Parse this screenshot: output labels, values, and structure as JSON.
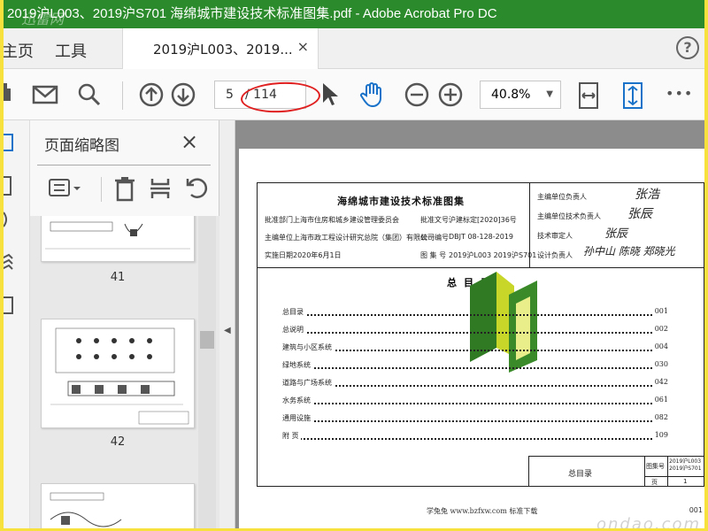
{
  "window": {
    "title": "2019沪L003、2019沪S701 海绵城市建设技术标准图集.pdf - Adobe Acrobat Pro DC",
    "watermark_overlay": "迅雷网"
  },
  "tabs": {
    "home": "主页",
    "tools": "工具",
    "document": "2019沪L003、2019...",
    "close_glyph": "×",
    "help_glyph": "?"
  },
  "toolbar": {
    "current_page": "5",
    "total_pages": "/ 114",
    "zoom": "40.8%",
    "more": "•••"
  },
  "thumb_panel": {
    "title": "页面缩略图",
    "close_glyph": "×",
    "pages": [
      "41",
      "42"
    ]
  },
  "document": {
    "main_title": "海绵城市建设技术标准图集",
    "header_rows": [
      {
        "label": "批准部门",
        "value": "上海市住房和城乡建设管理委员会",
        "label2": "批准文号",
        "value2": "沪建标定[2020]36号"
      },
      {
        "label": "主编单位",
        "value": "上海市政工程设计研究总院（集团）有限公司",
        "label2": "统一编号",
        "value2": "DBJT 08-128-2019"
      },
      {
        "label": "实施日期",
        "value": "2020年6月1日",
        "label2": "图 集 号",
        "value2": "2019沪L003  2019沪S701"
      }
    ],
    "right_rows": [
      {
        "label": "主编单位负责人",
        "sig": "张浩"
      },
      {
        "label": "主编单位技术负责人",
        "sig": "张辰"
      },
      {
        "label": "技术审定人",
        "sig": "张辰"
      },
      {
        "label": "设计负责人",
        "sig": "孙中山 陈晓 郑晓光"
      }
    ],
    "toc_title": "总目录",
    "toc": [
      {
        "name": "总目录",
        "page": "001"
      },
      {
        "name": "总说明",
        "page": "002"
      },
      {
        "name": "建筑与小区系统",
        "page": "004"
      },
      {
        "name": "绿地系统",
        "page": "030"
      },
      {
        "name": "道路与广场系统",
        "page": "042"
      },
      {
        "name": "水务系统",
        "page": "061"
      },
      {
        "name": "通用设施",
        "page": "082"
      },
      {
        "name": "附  页",
        "page": "109"
      }
    ],
    "titleblock": {
      "name": "总目录",
      "label_atlas": "图集号",
      "atlas_no": "2019沪L003 2019沪S701",
      "label_page": "页",
      "page": "1"
    },
    "footer": "学兔兔  www.bzfxw.com  标准下载",
    "footer_page": "001",
    "footer_watermark": "ondao.com"
  },
  "colors": {
    "titlebar": "#2b8a2b",
    "outer_frame": "#f7e13c",
    "accent_blue": "#1a73c9",
    "annotation_red": "#e02020"
  }
}
